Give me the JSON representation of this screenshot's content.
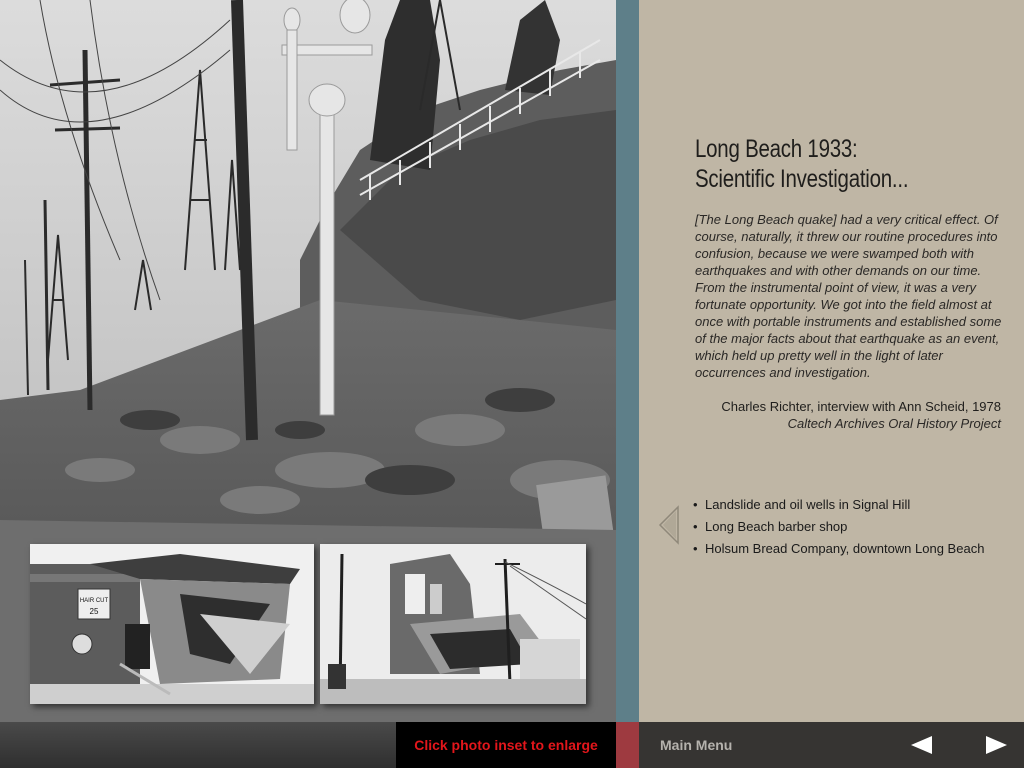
{
  "title": {
    "line1": "Long Beach 1933:",
    "line2": "Scientific Investigation..."
  },
  "quote": "[The Long Beach quake] had a very critical effect. Of course, naturally, it threw our routine procedures into confusion, because we were swamped both with earthquakes and with other demands on our time. From the instrumental point of view, it was a very fortunate opportunity. We got into the field almost at once with portable instruments and established some of the major facts about that earthquake as an event, which held up pretty well in the light of later occurrences and investigation.",
  "attribution": {
    "line1": "Charles Richter, interview with Ann Scheid, 1978",
    "line2": "Caltech Archives Oral History Project"
  },
  "inset_list": [
    {
      "label": "Landslide and oil wells in Signal Hill"
    },
    {
      "label": "Long Beach barber shop"
    },
    {
      "label": "Holsum Bread Company, downtown Long Beach"
    }
  ],
  "inset_signs": {
    "sign1": "HAIR CUT",
    "sign2": "25"
  },
  "footer": {
    "hint": "Click photo inset to enlarge",
    "main_menu": "Main Menu"
  },
  "colors": {
    "teal_bar": "#5e7f89",
    "panel_bg": "#bfb6a5",
    "hint_text": "#e3161b",
    "separator": "#9e3a40"
  },
  "icons": {
    "previous": "left-triangle-icon",
    "next": "right-triangle-icon",
    "bullet": "bullet-dot"
  }
}
